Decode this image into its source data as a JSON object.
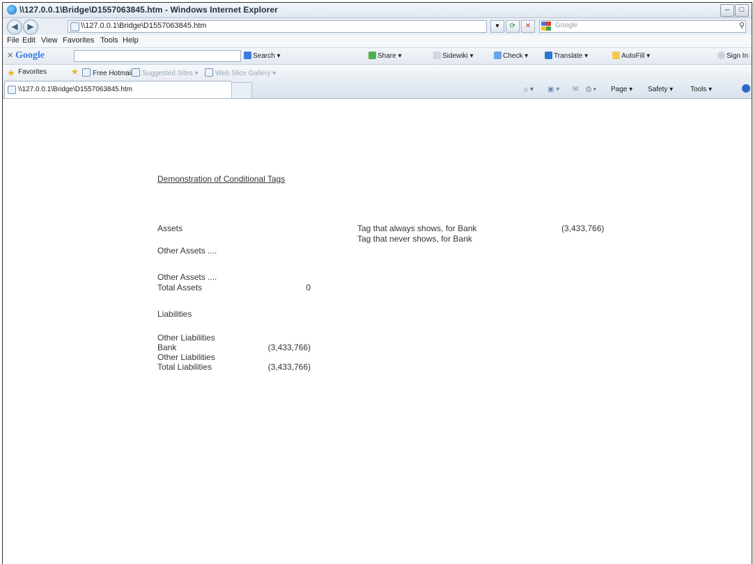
{
  "window": {
    "title": "\\\\127.0.0.1\\Bridge\\D1557063845.htm - Windows Internet Explorer",
    "minimize": "–",
    "maximize": "□"
  },
  "address": {
    "url": "\\\\127.0.0.1\\Bridge\\D1557063845.htm",
    "search_placeholder": "Google"
  },
  "menu": [
    "File",
    "Edit",
    "View",
    "Favorites",
    "Tools",
    "Help"
  ],
  "google_toolbar": {
    "brand": "Google",
    "items": [
      "Search",
      "Share",
      "Sidewiki",
      "Check",
      "Translate",
      "AutoFill",
      "Sign In"
    ]
  },
  "favorites": {
    "label": "Favorites",
    "items": [
      "Free Hotmail",
      "Suggested Sites",
      "Web Slice Gallery"
    ]
  },
  "tab": {
    "title": "\\\\127.0.0.1\\Bridge\\D1557063845.htm"
  },
  "command_bar": [
    "Page",
    "Safety",
    "Tools"
  ],
  "document": {
    "heading": "Demonstration of Conditional Tags",
    "left": {
      "assets": "Assets",
      "other_assets_1": "Other Assets ....",
      "other_assets_2": "Other Assets ....",
      "total_assets": "Total Assets",
      "total_assets_value": "0",
      "liabilities": "Liabilities",
      "other_liabilities_1": "Other Liabilities",
      "bank": "Bank",
      "bank_value": "(3,433,766)",
      "other_liabilities_2": "Other Liabilities",
      "total_liabilities": "Total Liabilities",
      "total_liabilities_value": "(3,433,766)"
    },
    "right": {
      "tag_always": "Tag that always shows, for Bank",
      "tag_always_value": "(3,433,766)",
      "tag_never": "Tag that never shows, for Bank"
    }
  }
}
